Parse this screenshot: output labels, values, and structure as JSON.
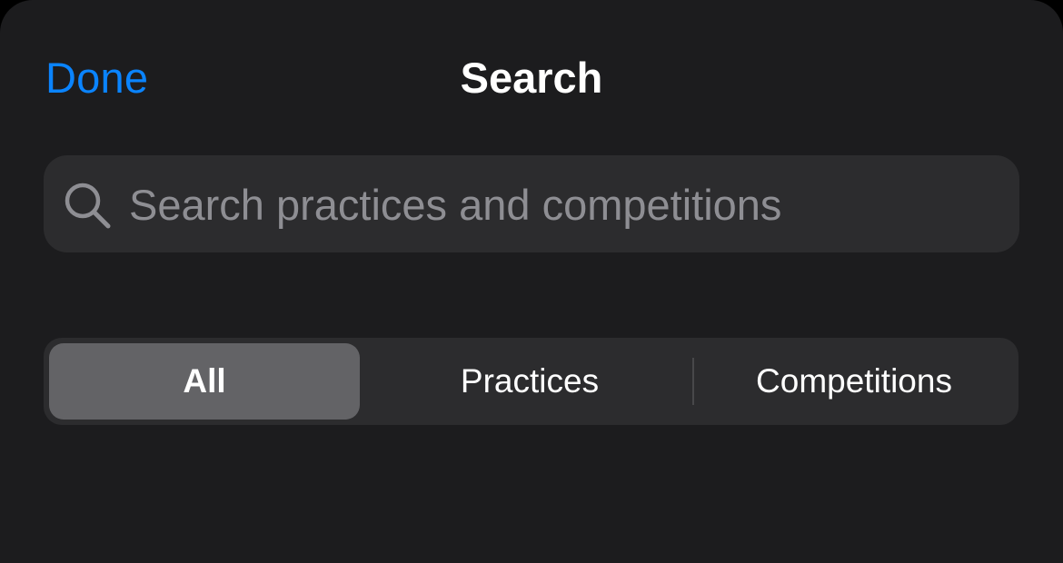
{
  "nav": {
    "done_label": "Done",
    "title": "Search"
  },
  "search": {
    "placeholder": "Search practices and competitions",
    "value": "",
    "icon": "magnifying-glass"
  },
  "segments": {
    "items": [
      {
        "label": "All",
        "selected": true
      },
      {
        "label": "Practices",
        "selected": false
      },
      {
        "label": "Competitions",
        "selected": false
      }
    ]
  },
  "colors": {
    "background": "#1c1c1e",
    "accent": "#0a84ff",
    "field_background": "#2c2c2e",
    "selected_segment": "#636366",
    "placeholder": "#8e8e93"
  }
}
